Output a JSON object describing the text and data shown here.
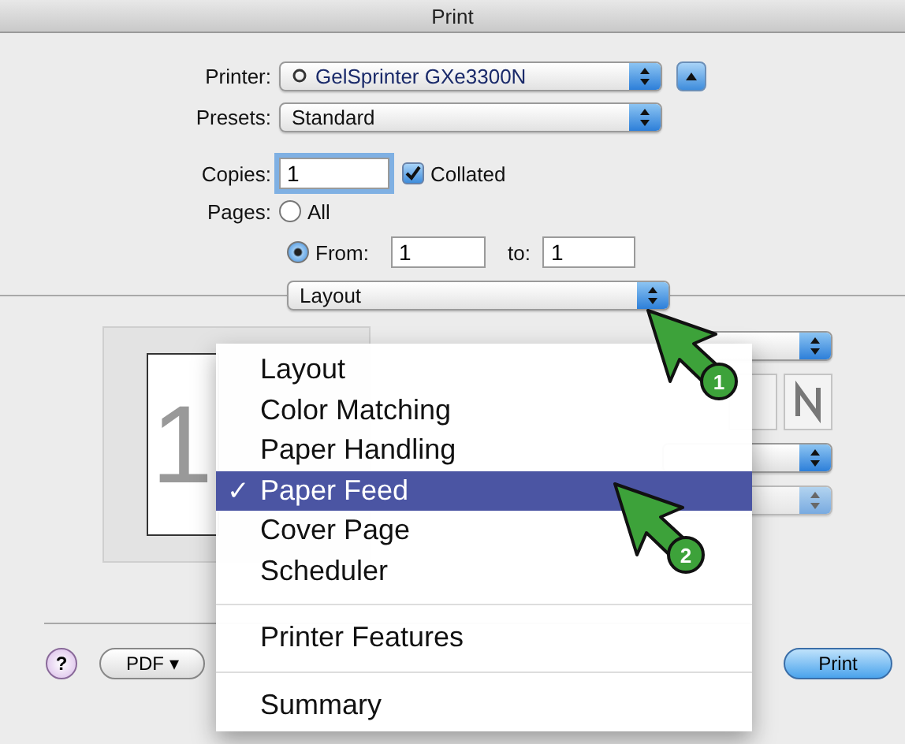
{
  "window": {
    "title": "Print"
  },
  "printer": {
    "label": "Printer:",
    "value": "GelSprinter GXe3300N"
  },
  "presets": {
    "label": "Presets:",
    "value": "Standard"
  },
  "copies": {
    "label": "Copies:",
    "value": "1",
    "collated": {
      "label": "Collated",
      "checked": true
    }
  },
  "pages": {
    "label": "Pages:",
    "options": [
      {
        "label": "All",
        "selected": false
      },
      {
        "label": "From:",
        "selected": true
      }
    ],
    "from": "1",
    "to_label": "to:",
    "to": "1"
  },
  "panel_menu": {
    "value": "Layout"
  },
  "preview": {
    "page_number": "1"
  },
  "menu": {
    "groups": [
      [
        {
          "label": "Layout",
          "selected": false
        },
        {
          "label": "Color Matching",
          "selected": false
        },
        {
          "label": "Paper Handling",
          "selected": false
        },
        {
          "label": "Paper Feed",
          "selected": true,
          "mark": "✓"
        },
        {
          "label": "Cover Page",
          "selected": false
        },
        {
          "label": "Scheduler",
          "selected": false
        }
      ],
      [
        {
          "label": "Printer Features",
          "selected": false
        }
      ],
      [
        {
          "label": "Summary",
          "selected": false
        }
      ]
    ]
  },
  "footer": {
    "help": "?",
    "pdf": "PDF ▾",
    "print": "Print"
  },
  "callouts": [
    {
      "number": "1"
    },
    {
      "number": "2"
    }
  ]
}
